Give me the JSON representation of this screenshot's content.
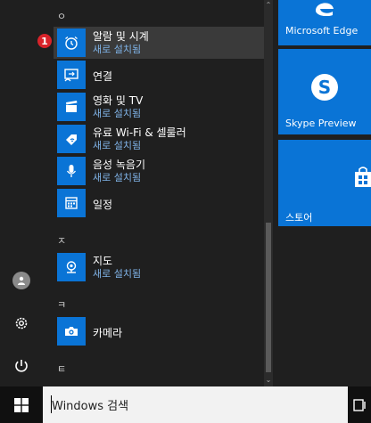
{
  "badge": "1",
  "sections": {
    "o": "ㅇ",
    "j": "ㅈ",
    "k": "ㅋ",
    "t": "ㅌ"
  },
  "apps": [
    {
      "name": "알람 및 시계",
      "sub": "새로 설치됨",
      "icon": "alarm-clock-icon"
    },
    {
      "name": "연결",
      "icon": "connect-icon"
    },
    {
      "name": "영화 및 TV",
      "sub": "새로 설치됨",
      "icon": "film-icon"
    },
    {
      "name": "유료 Wi-Fi & 셀룰러",
      "sub": "새로 설치됨",
      "icon": "wifi-tag-icon"
    },
    {
      "name": "음성 녹음기",
      "sub": "새로 설치됨",
      "icon": "microphone-icon"
    },
    {
      "name": "일정",
      "icon": "calendar-icon"
    },
    {
      "name": "지도",
      "sub": "새로 설치됨",
      "icon": "map-icon"
    },
    {
      "name": "카메라",
      "icon": "camera-icon"
    }
  ],
  "tiles": {
    "edge": "Microsoft Edge",
    "skype": "Skype Preview",
    "store": "스토어"
  },
  "search": {
    "text": "Windows 검색"
  },
  "colors": {
    "tile_blue": "#0a74d6",
    "badge_red": "#d8232a",
    "sub_text": "#7fb2e6"
  }
}
